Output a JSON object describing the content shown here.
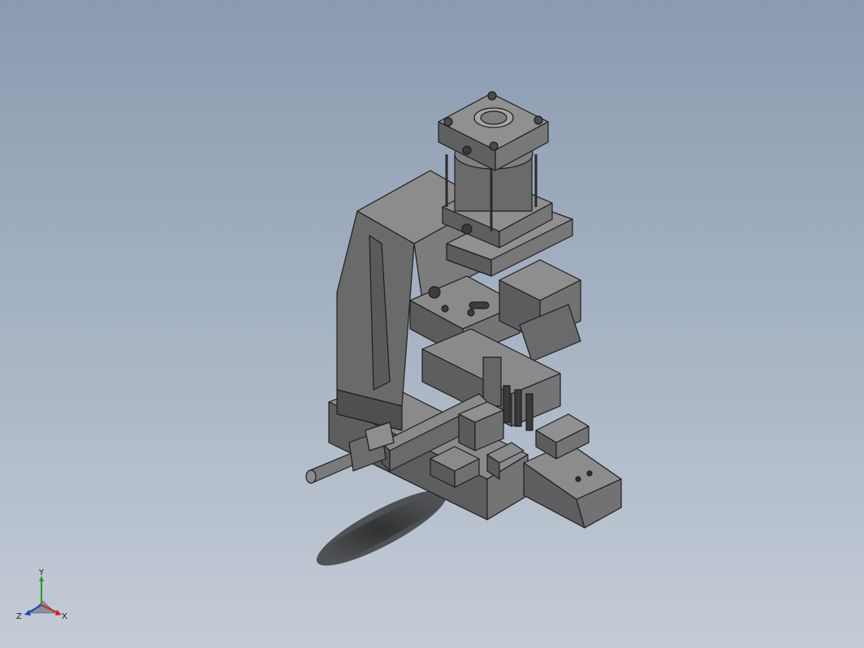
{
  "viewport": {
    "background_top": "#8a9bb0",
    "background_bottom": "#c4ccd6",
    "model_color": "#6e6e6e"
  },
  "triad": {
    "x_label": "X",
    "y_label": "Y",
    "z_label": "Z",
    "x_color": "#d02020",
    "y_color": "#20a020",
    "z_color": "#2040c0"
  }
}
